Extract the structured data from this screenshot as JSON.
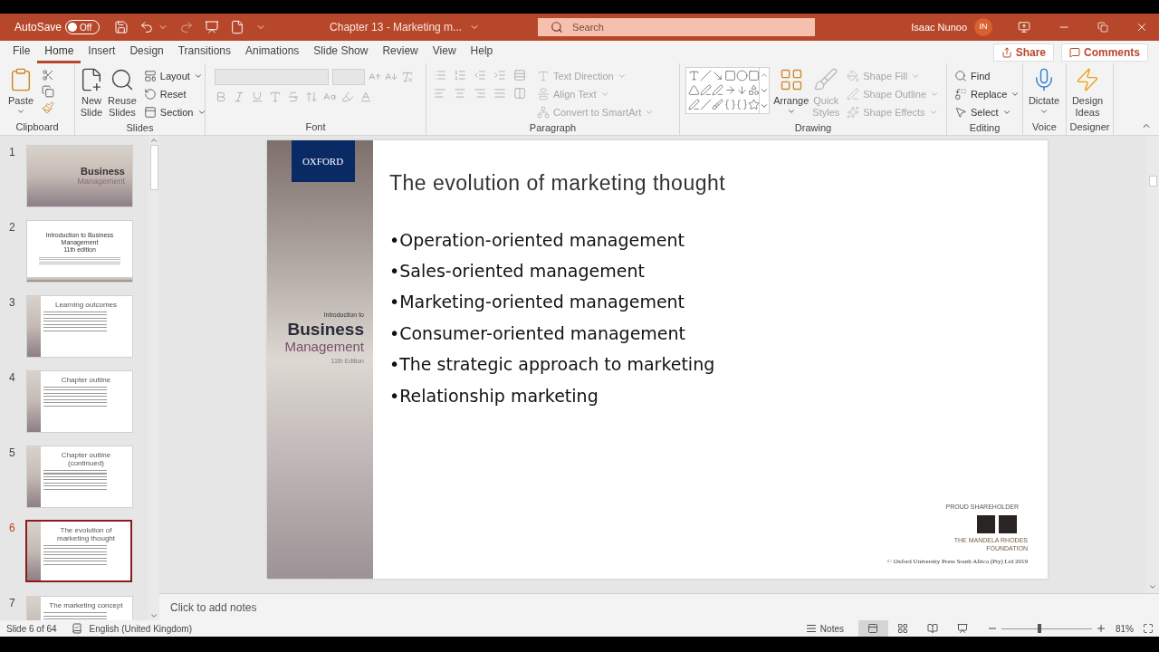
{
  "title_bar": {
    "autosave_label": "AutoSave",
    "autosave": {
      "on": false,
      "label": "Off"
    },
    "document_title": "Chapter 13 - Marketing m...",
    "search": {
      "placeholder": "Search"
    },
    "user_name": "Isaac Nunoo",
    "user_initials": "IN"
  },
  "tabs": [
    {
      "label": "File",
      "selected": false
    },
    {
      "label": "Home",
      "selected": true
    },
    {
      "label": "Insert",
      "selected": false
    },
    {
      "label": "Design",
      "selected": false
    },
    {
      "label": "Transitions",
      "selected": false
    },
    {
      "label": "Animations",
      "selected": false
    },
    {
      "label": "Slide Show",
      "selected": false
    },
    {
      "label": "Review",
      "selected": false
    },
    {
      "label": "View",
      "selected": false
    },
    {
      "label": "Help",
      "selected": false
    }
  ],
  "share_button": "Share",
  "comments_button": "Comments",
  "ribbon": {
    "clipboard": {
      "label": "Clipboard",
      "paste": "Paste"
    },
    "slides": {
      "label": "Slides",
      "new_slide": [
        "New",
        "Slide"
      ],
      "reuse_slides": [
        "Reuse",
        "Slides"
      ],
      "commands": [
        "Layout",
        "Reset",
        "Section"
      ]
    },
    "font": {
      "label": "Font"
    },
    "paragraph": {
      "label": "Paragraph",
      "commands": [
        {
          "label": "Text Direction",
          "disabled": true
        },
        {
          "label": "Align Text",
          "disabled": true
        },
        {
          "label": "Convert to SmartArt",
          "disabled": true
        }
      ]
    },
    "drawing": {
      "label": "Drawing",
      "arrange": "Arrange",
      "quick_styles": {
        "lines": [
          "Quick",
          "Styles"
        ],
        "disabled": true
      },
      "commands": [
        {
          "label": "Shape Fill",
          "disabled": true
        },
        {
          "label": "Shape Outline",
          "disabled": true
        },
        {
          "label": "Shape Effects",
          "disabled": true
        }
      ]
    },
    "editing": {
      "label": "Editing",
      "commands": [
        "Find",
        "Replace",
        "Select"
      ]
    },
    "voice": {
      "label": "Voice",
      "dictate": "Dictate"
    },
    "designer": {
      "label": "Designer",
      "design_ideas": [
        "Design",
        "Ideas"
      ]
    }
  },
  "thumbnails": [
    {
      "number": "1",
      "selected": false,
      "kind": "cover",
      "lines": [
        "Business",
        "Management"
      ]
    },
    {
      "number": "2",
      "selected": false,
      "kind": "title",
      "lines": [
        "Introduction to Business",
        "Management",
        "11th edition"
      ]
    },
    {
      "number": "3",
      "selected": false,
      "kind": "content",
      "lines": [
        "Learning outcomes"
      ]
    },
    {
      "number": "4",
      "selected": false,
      "kind": "content",
      "lines": [
        "Chapter outline"
      ]
    },
    {
      "number": "5",
      "selected": false,
      "kind": "content",
      "lines": [
        "Chapter outline (continued)"
      ]
    },
    {
      "number": "6",
      "selected": true,
      "kind": "content",
      "lines": [
        "The evolution of marketing thought"
      ]
    },
    {
      "number": "7",
      "selected": false,
      "kind": "content",
      "lines": [
        "The marketing concept"
      ]
    }
  ],
  "slide": {
    "brand": "OXFORD",
    "cover_intro": "Introduction to",
    "cover_title": "Business",
    "cover_subtitle": "Management",
    "edition": "11th Edition",
    "title": "The evolution of marketing thought",
    "bullets": [
      "•Operation-oriented management",
      "•Sales-oriented management",
      "•Marketing-oriented management",
      "•Consumer-oriented management",
      "•The strategic approach to marketing",
      "•Relationship marketing"
    ],
    "badge_caption": "PROUD SHAREHOLDER",
    "foundation": [
      "THE MANDELA RHODES",
      "FOUNDATION"
    ],
    "copyright": "© Oxford University Press South Africa (Pty) Ltd 2019"
  },
  "notes": {
    "placeholder": "Click to add notes"
  },
  "status_bar": {
    "slide_counter": "Slide 6 of 64",
    "language": "English (United Kingdom)",
    "notes_button": "Notes",
    "views": [
      {
        "kind": "normal",
        "selected": true
      },
      {
        "kind": "sorter",
        "selected": false
      },
      {
        "kind": "reading",
        "selected": false
      },
      {
        "kind": "slideshow",
        "selected": false
      }
    ],
    "zoom": {
      "level": 0.42,
      "reading": "81%"
    }
  }
}
